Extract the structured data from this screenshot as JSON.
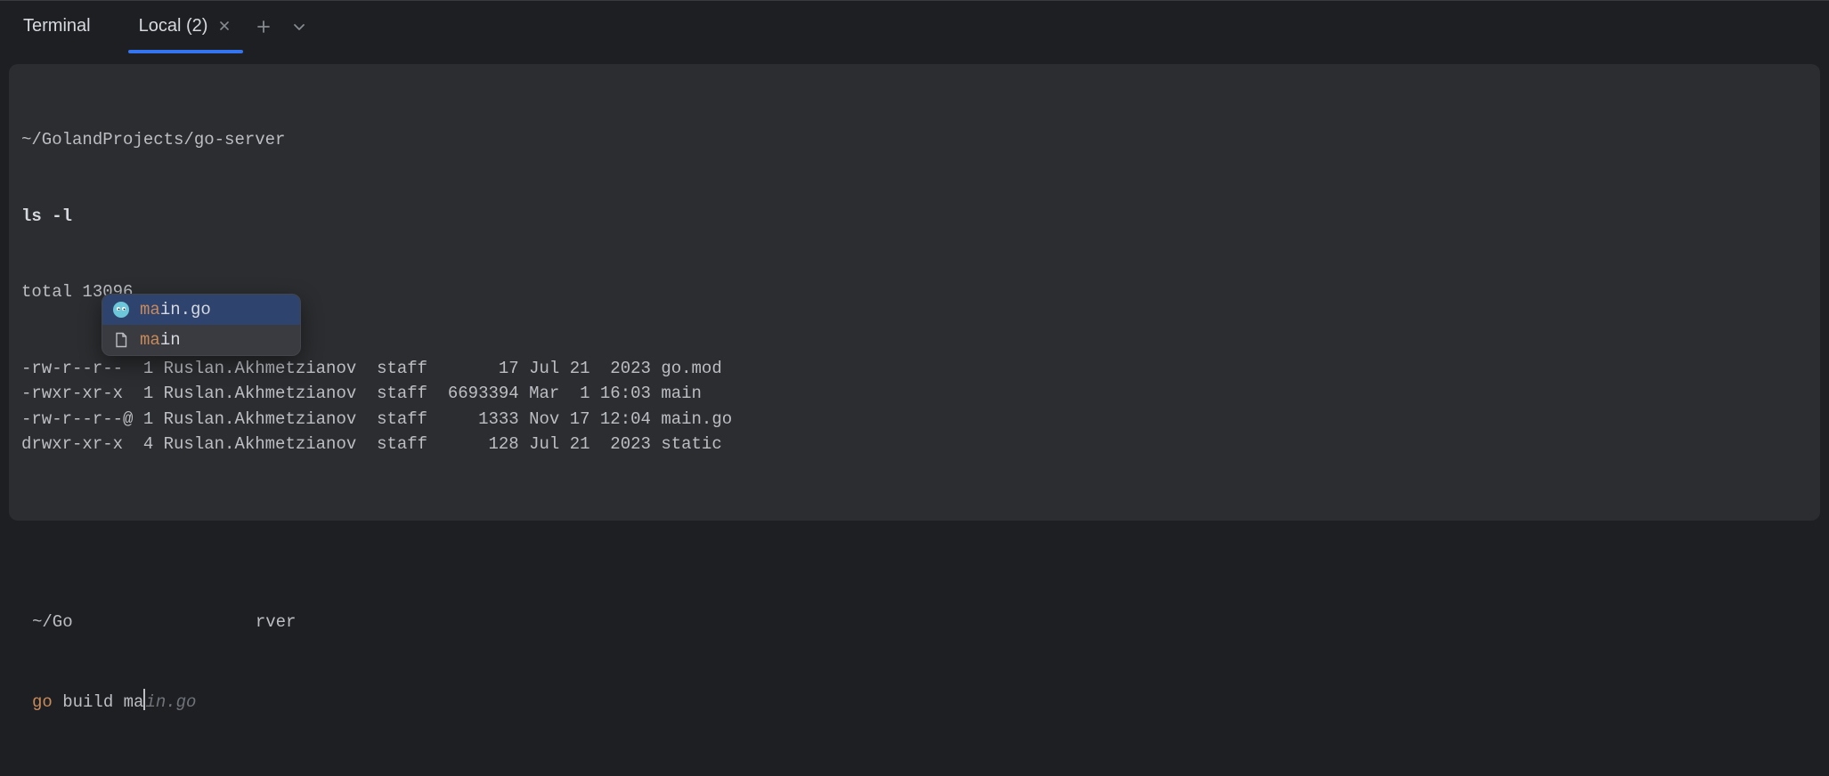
{
  "tabbar": {
    "title": "Terminal",
    "tabs": [
      {
        "label": "Local (2)",
        "active": true
      }
    ]
  },
  "output": {
    "cwd": "~/GolandProjects/go-server",
    "command": "ls -l",
    "total_line": "total 13096",
    "rows": [
      {
        "perm": "-rw-r--r-- ",
        "links": "1",
        "owner": "Ruslan.Akhmetzianov",
        "group": "staff",
        "size": "17",
        "date": "Jul 21  2023",
        "name": "go.mod"
      },
      {
        "perm": "-rwxr-xr-x ",
        "links": "1",
        "owner": "Ruslan.Akhmetzianov",
        "group": "staff",
        "size": "6693394",
        "date": "Mar  1 16:03",
        "name": "main"
      },
      {
        "perm": "-rw-r--r--@",
        "links": "1",
        "owner": "Ruslan.Akhmetzianov",
        "group": "staff",
        "size": "1333",
        "date": "Nov 17 12:04",
        "name": "main.go"
      },
      {
        "perm": "drwxr-xr-x ",
        "links": "4",
        "owner": "Ruslan.Akhmetzianov",
        "group": "staff",
        "size": "128",
        "date": "Jul 21  2023",
        "name": "static"
      }
    ]
  },
  "prompt": {
    "cwd": "~/GolandProjects/go-server",
    "cwd_visible_prefix": "~/Go",
    "cwd_visible_suffix": "rver",
    "go_keyword": "go",
    "subcommand": "build",
    "typed": "ma",
    "ghost": "in.go"
  },
  "completion": {
    "items": [
      {
        "icon": "go-file-icon",
        "match": "ma",
        "rest": "in.go",
        "selected": true
      },
      {
        "icon": "generic-file-icon",
        "match": "ma",
        "rest": "in",
        "selected": false
      }
    ]
  }
}
